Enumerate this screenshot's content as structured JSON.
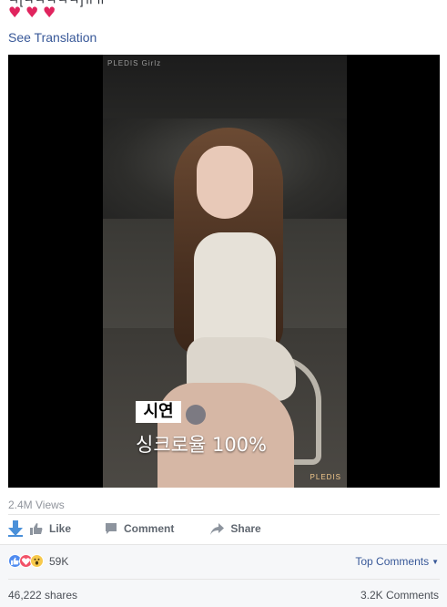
{
  "post": {
    "cut_text": "ㅋ[ㅋㅋㅋㅋㅋ]ㅠㅠ",
    "hearts": [
      "♥",
      "♥",
      "♥"
    ],
    "see_translation": "See Translation"
  },
  "video": {
    "watermark_top": "PLEDIS Girlz",
    "watermark_bottom": "PLEDIS",
    "name_tag": "시연",
    "caption": "싱크로율 100%"
  },
  "stats": {
    "views": "2.4M Views"
  },
  "actions": {
    "like": "Like",
    "comment": "Comment",
    "share": "Share"
  },
  "summary": {
    "reaction_count": "59K",
    "top_comments": "Top Comments",
    "shares": "46,222 shares",
    "comments": "3.2K Comments"
  },
  "colors": {
    "link": "#385898",
    "heart": "#e0245e",
    "like_reaction": "#4f8bf0",
    "love_reaction": "#f25268",
    "wow_reaction": "#f7c94c"
  }
}
